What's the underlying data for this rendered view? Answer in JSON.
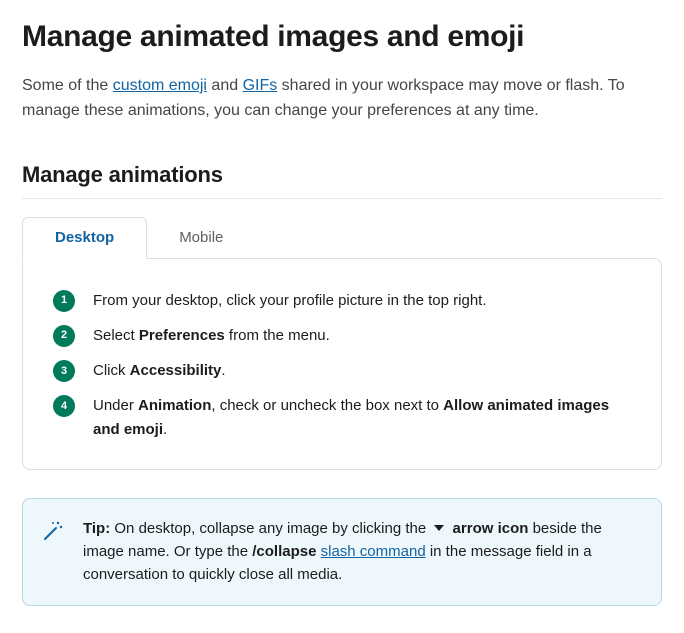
{
  "header": {
    "title": "Manage animated images and emoji"
  },
  "intro": {
    "part1": "Some of the ",
    "link1": "custom emoji",
    "part2": " and ",
    "link2": "GIFs",
    "part3": " shared in your workspace may move or flash. To manage these animations, you can change your preferences at any time."
  },
  "section": {
    "title": "Manage animations"
  },
  "tabs": {
    "items": [
      {
        "label": "Desktop",
        "active": true
      },
      {
        "label": "Mobile",
        "active": false
      }
    ]
  },
  "steps": [
    {
      "num": "1",
      "pre": "From your desktop, click your profile picture in the top right.",
      "bold1": "",
      "mid": "",
      "bold2": "",
      "post": ""
    },
    {
      "num": "2",
      "pre": "Select ",
      "bold1": "Preferences",
      "mid": " from the menu.",
      "bold2": "",
      "post": ""
    },
    {
      "num": "3",
      "pre": " Click ",
      "bold1": "Accessibility",
      "mid": ".",
      "bold2": "",
      "post": ""
    },
    {
      "num": "4",
      "pre": " Under ",
      "bold1": "Animation",
      "mid": ", check or uncheck the box next to ",
      "bold2": "Allow animated images and emoji",
      "post": "."
    }
  ],
  "tip": {
    "label": "Tip:",
    "part1": " On desktop, collapse any image by clicking the ",
    "iconword": " arrow icon",
    "part2": " beside the image name. Or type the ",
    "bold_cmd": "/collapse",
    "space": " ",
    "link": "slash command",
    "part3": " in the message field in a conversation to quickly close all media."
  }
}
